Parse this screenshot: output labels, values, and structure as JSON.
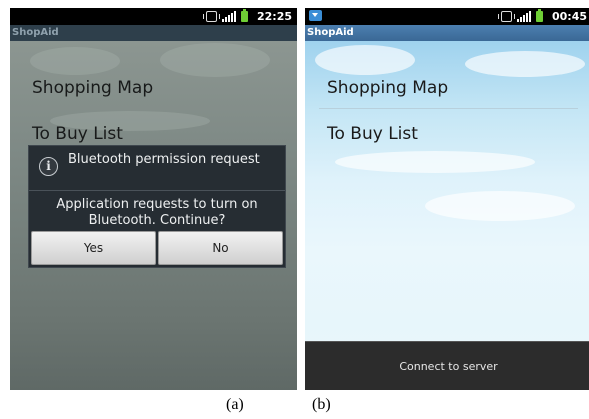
{
  "screen_a": {
    "status_time": "22:25",
    "app_title": "ShopAid",
    "menu": [
      "Shopping Map",
      "To Buy List"
    ],
    "dialog": {
      "title": "Bluetooth permission request",
      "message": "Application requests to turn on Bluetooth. Continue?",
      "yes_label": "Yes",
      "no_label": "No"
    }
  },
  "screen_b": {
    "status_time": "00:45",
    "app_title": "ShopAid",
    "menu": [
      "Shopping Map",
      "To Buy List"
    ],
    "bottom_button": "Connect to server"
  },
  "captions": [
    "(a)",
    "(b)"
  ],
  "colors": {
    "battery": "#6fcf35",
    "titlebar_b": "#4c7fb0",
    "dialog_bg": "#262d33"
  }
}
